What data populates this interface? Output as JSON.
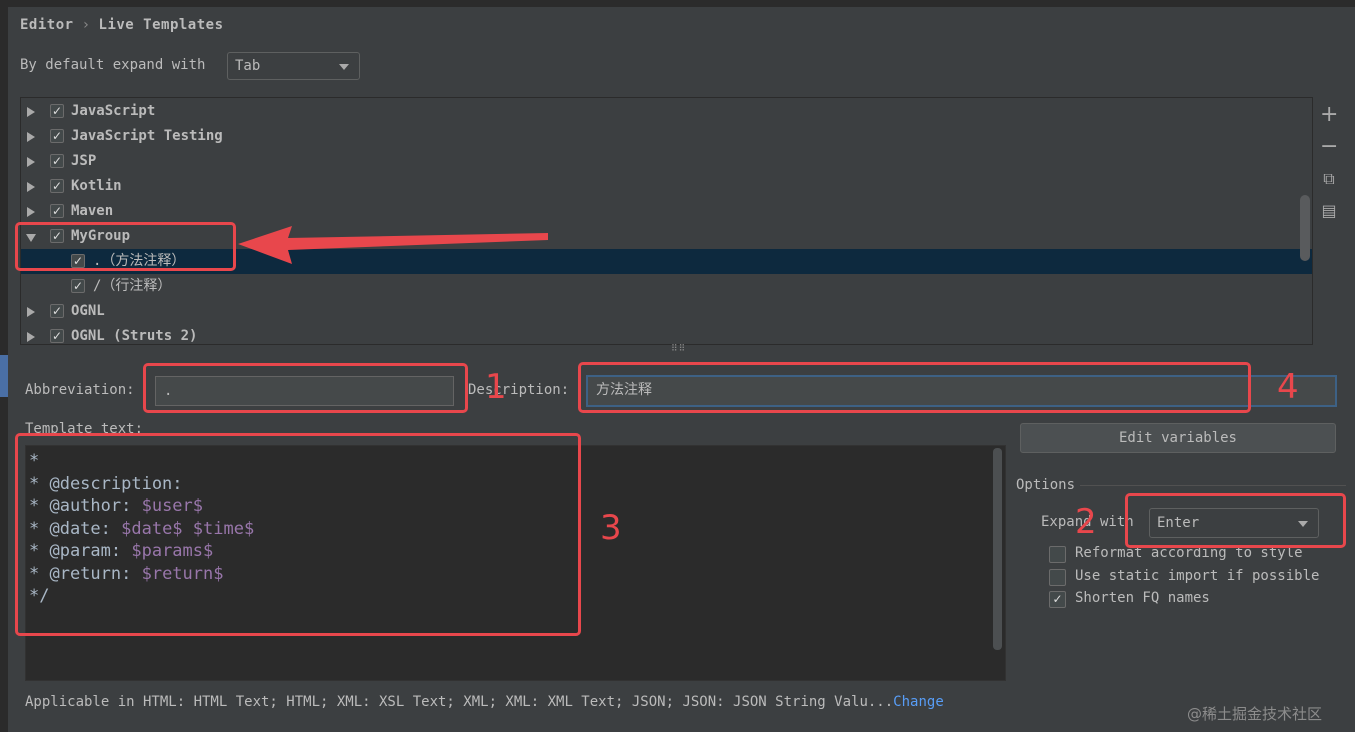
{
  "breadcrumb": {
    "parent": "Editor",
    "separator": "›",
    "current": "Live Templates"
  },
  "expand_default": {
    "label": "By default expand with",
    "value": "Tab"
  },
  "tree": [
    {
      "label": "JavaScript",
      "checked": true,
      "expanded": false
    },
    {
      "label": "JavaScript Testing",
      "checked": true,
      "expanded": false
    },
    {
      "label": "JSP",
      "checked": true,
      "expanded": false
    },
    {
      "label": "Kotlin",
      "checked": true,
      "expanded": false
    },
    {
      "label": "Maven",
      "checked": true,
      "expanded": false
    },
    {
      "label": "MyGroup",
      "checked": true,
      "expanded": true
    },
    {
      "label": ".（方法注释）",
      "checked": true,
      "child": true,
      "selected": true
    },
    {
      "label": "/（行注释）",
      "checked": true,
      "child": true
    },
    {
      "label": "OGNL",
      "checked": true,
      "expanded": false
    },
    {
      "label": "OGNL (Struts 2)",
      "checked": true,
      "expanded": false
    }
  ],
  "side_buttons": {
    "add": {
      "icon": "plus-icon",
      "glyph": "+"
    },
    "remove": {
      "icon": "minus-icon",
      "glyph": "−"
    },
    "copy": {
      "icon": "copy-icon",
      "glyph": "⧉"
    },
    "restore": {
      "icon": "restore-icon",
      "glyph": "▤"
    }
  },
  "abbreviation": {
    "label": "Abbreviation:",
    "value": "."
  },
  "description": {
    "label": "Description:",
    "value": "方法注释"
  },
  "template_text": {
    "label": "Template text:",
    "lines": [
      [
        {
          "t": "*"
        }
      ],
      [
        {
          "t": "* @description:"
        }
      ],
      [
        {
          "t": "* @author: "
        },
        {
          "v": "$user$"
        }
      ],
      [
        {
          "t": "* @date: "
        },
        {
          "v": "$date$"
        },
        {
          "t": " "
        },
        {
          "v": "$time$"
        }
      ],
      [
        {
          "t": "* @param: "
        },
        {
          "v": "$params$"
        }
      ],
      [
        {
          "t": "* @return: "
        },
        {
          "v": "$return$"
        }
      ],
      [
        {
          "t": "*/"
        }
      ]
    ]
  },
  "edit_variables_label": "Edit variables",
  "options": {
    "title": "Options",
    "expand_with_label": "Expand with",
    "expand_with_value": "Enter",
    "checkboxes": [
      {
        "label": "Reformat according to style",
        "checked": false
      },
      {
        "label": "Use static import if possible",
        "checked": false
      },
      {
        "label": "Shorten FQ names",
        "checked": true
      }
    ]
  },
  "applicable": {
    "text": "Applicable in HTML: HTML Text; HTML; XML: XSL Text; XML; XML: XML Text; JSON; JSON: JSON String Valu...",
    "link": "Change"
  },
  "annotations": [
    "1",
    "2",
    "3",
    "4"
  ],
  "watermark": "@稀土掘金技术社区",
  "colors": {
    "accent": "#e8474c",
    "link": "#589df6",
    "selection": "#0d293e",
    "template_var": "#9876aa"
  }
}
